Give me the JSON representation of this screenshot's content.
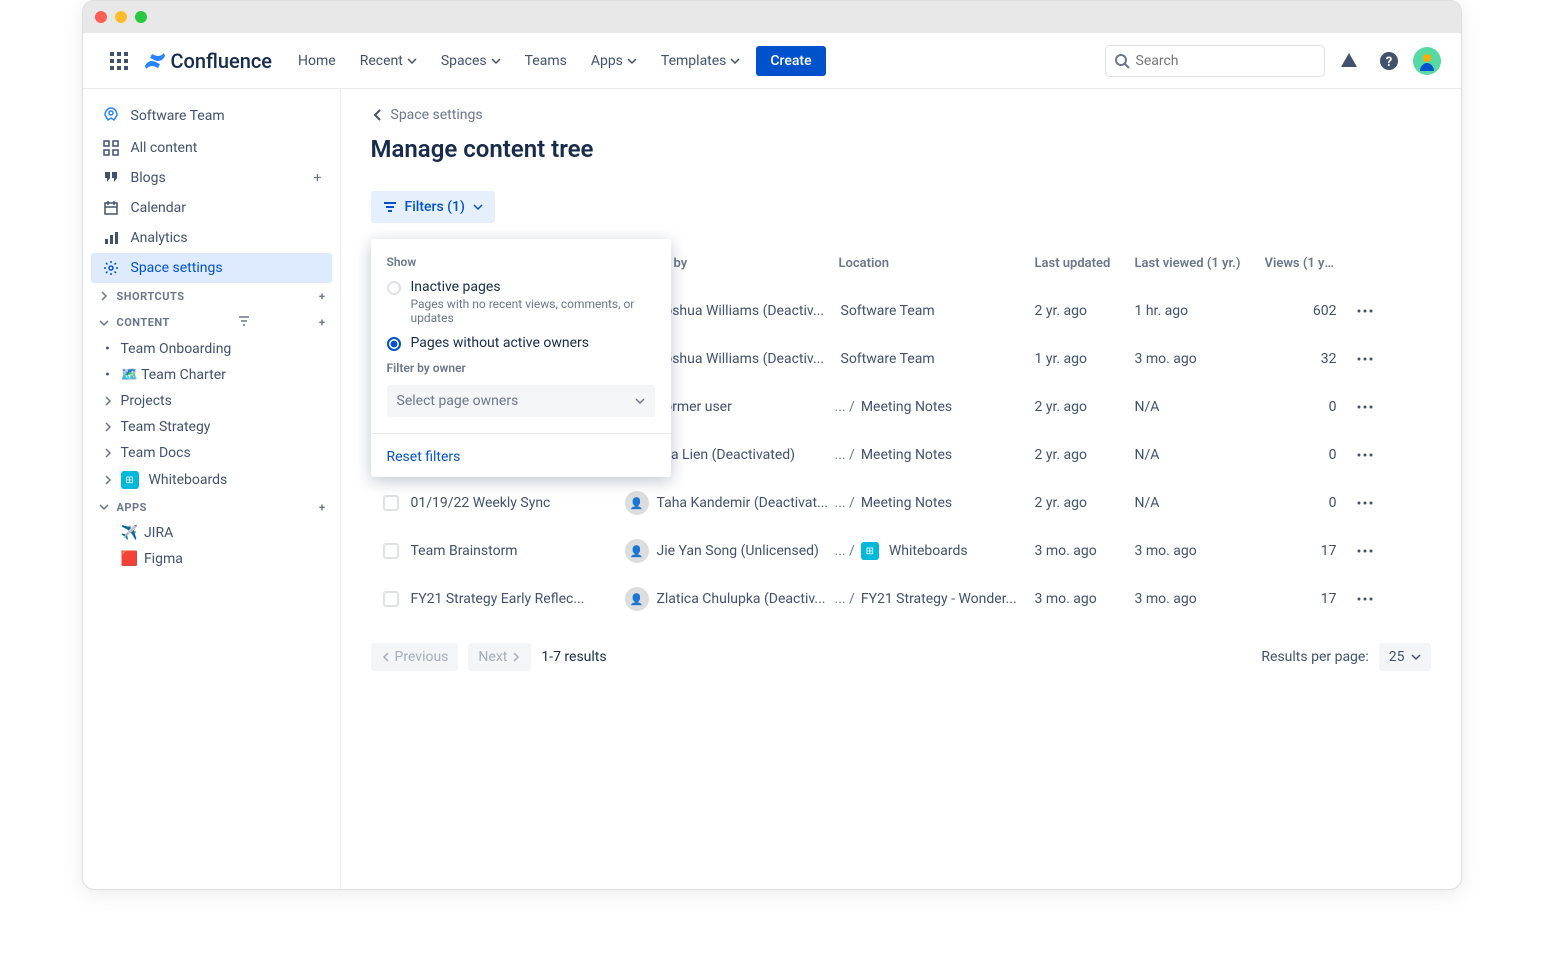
{
  "nav": {
    "brand": "Confluence",
    "items": [
      "Home",
      "Recent",
      "Spaces",
      "Teams",
      "Apps",
      "Templates"
    ],
    "create": "Create",
    "search_placeholder": "Search"
  },
  "sidebar": {
    "space_name": "Software Team",
    "primary": [
      {
        "icon": "grid",
        "label": "All content"
      },
      {
        "icon": "quote",
        "label": "Blogs",
        "add": true
      },
      {
        "icon": "calendar",
        "label": "Calendar"
      },
      {
        "icon": "analytics",
        "label": "Analytics"
      },
      {
        "icon": "gear",
        "label": "Space settings",
        "active": true
      }
    ],
    "shortcuts_hdr": "SHORTCUTS",
    "content_hdr": "CONTENT",
    "content": [
      {
        "label": "Team Onboarding",
        "bullet": true
      },
      {
        "label": "🗺️ Team Charter",
        "bullet": true
      },
      {
        "label": "Projects",
        "chev": true
      },
      {
        "label": "Team Strategy",
        "chev": true
      },
      {
        "label": "Team Docs",
        "chev": true
      },
      {
        "label": "Whiteboards",
        "chev": true,
        "wb": true
      }
    ],
    "apps_hdr": "APPS",
    "apps": [
      {
        "label": "JIRA",
        "emoji": "✈️"
      },
      {
        "label": "Figma",
        "emoji": "🟥"
      }
    ]
  },
  "main": {
    "breadcrumb": "Space settings",
    "title": "Manage content tree",
    "filters_label": "Filters (1)",
    "headers": {
      "created": "Created by",
      "location": "Location",
      "updated": "Last updated",
      "viewed": "Last viewed (1 yr.)",
      "views": "Views (1 yr.)"
    },
    "popover": {
      "show": "Show",
      "opt1_title": "Inactive pages",
      "opt1_desc": "Pages with no recent views, comments, or updates",
      "opt2_title": "Pages without active owners",
      "filter_by": "Filter by owner",
      "select_owners": "Select page owners",
      "reset": "Reset filters"
    },
    "rows": [
      {
        "title": "",
        "created": "Joshua Williams (Deactiv...",
        "loc_pre": "",
        "loc": "Software Team",
        "updated": "2 yr. ago",
        "viewed": "1 hr. ago",
        "views": "602"
      },
      {
        "title": "",
        "created": "Joshua Williams (Deactiv...",
        "loc_pre": "",
        "loc": "Software Team",
        "updated": "1 yr. ago",
        "viewed": "3 mo. ago",
        "views": "32"
      },
      {
        "title": "",
        "created": "Former user",
        "loc_pre": "...  /",
        "loc": "Meeting Notes",
        "updated": "2 yr. ago",
        "viewed": "N/A",
        "views": "0"
      },
      {
        "title": "",
        "created": "Eva Lien (Deactivated)",
        "loc_pre": "...  /",
        "loc": "Meeting Notes",
        "updated": "2 yr. ago",
        "viewed": "N/A",
        "views": "0"
      },
      {
        "title": "01/19/22 Weekly Sync",
        "created": "Taha Kandemir (Deactivat...",
        "loc_pre": "...  /",
        "loc": "Meeting Notes",
        "updated": "2 yr. ago",
        "viewed": "N/A",
        "views": "0"
      },
      {
        "title": "Team Brainstorm",
        "created": "Jie Yan Song (Unlicensed)",
        "loc_pre": "...  /",
        "loc": "Whiteboards",
        "wb": true,
        "updated": "3 mo. ago",
        "viewed": "3 mo. ago",
        "views": "17"
      },
      {
        "title": "FY21 Strategy Early Reflec...",
        "created": "Zlatica Chulupka (Deactiv...",
        "loc_pre": "...  /",
        "loc": "FY21 Strategy - Wonder...",
        "updated": "3 mo. ago",
        "viewed": "3 mo. ago",
        "views": "17"
      }
    ],
    "pagination": {
      "prev": "Previous",
      "next": "Next",
      "results": "1-7 results",
      "rpp_label": "Results per page:",
      "rpp_value": "25"
    }
  }
}
